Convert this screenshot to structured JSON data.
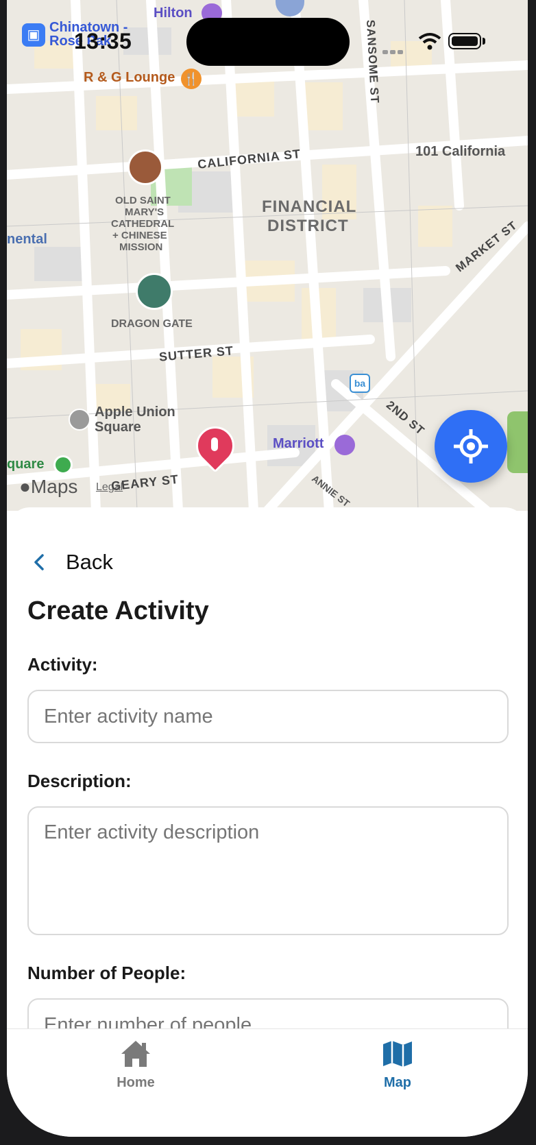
{
  "status_bar": {
    "time": "13:35",
    "transit_chip": "Chinatown - Rose Pak"
  },
  "map": {
    "labels": {
      "hilton": "Hilton",
      "lounge": "R & G Lounge",
      "california_st": "CALIFORNIA ST",
      "sansome_st": "SANSOME ST",
      "california101": "101 California",
      "financial_1": "FINANCIAL",
      "financial_2": "DISTRICT",
      "old_saint_1": "OLD SAINT",
      "old_saint_2": "MARY'S",
      "old_saint_3": "CATHEDRAL",
      "old_saint_4": "+ CHINESE",
      "old_saint_5": "MISSION",
      "nental": "nental",
      "market_st": "MARKET ST",
      "dragon_gate": "DRAGON GATE",
      "sutter_st": "SUTTER ST",
      "second_st": "2ND ST",
      "apple_1": "Apple Union",
      "apple_2": "Square",
      "marriott": "Marriott",
      "square": "quare",
      "geary_st": "GEARY ST",
      "annie_st": "ANNIE ST",
      "maps_brand": "Maps",
      "legal": "Legal"
    }
  },
  "sheet": {
    "back_label": "Back",
    "title": "Create Activity",
    "activity_label": "Activity:",
    "activity_placeholder": "Enter activity name",
    "description_label": "Description:",
    "description_placeholder": "Enter activity description",
    "people_label": "Number of People:",
    "people_placeholder": "Enter number of people"
  },
  "tabs": [
    {
      "label": "Home",
      "icon": "house-icon",
      "active": false
    },
    {
      "label": "Map",
      "icon": "map-icon",
      "active": true
    }
  ],
  "colors": {
    "accent": "#1f6ea8",
    "locate_button": "#2f6ff5",
    "pin": "#e03a5c",
    "inactive_tab": "#7a7a7a"
  }
}
